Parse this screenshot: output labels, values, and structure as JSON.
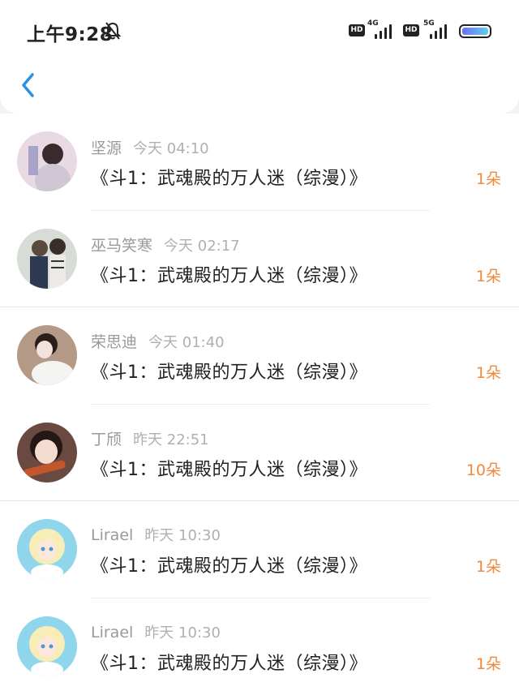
{
  "status_bar": {
    "time": "上午9:28",
    "hd1": "HD",
    "network1": "4G",
    "hd2": "HD",
    "network2": "5G"
  },
  "header": {
    "back_icon": "chevron-left-icon"
  },
  "items": [
    {
      "name": "坚源",
      "time": "今天 04:10",
      "title": "《斗1：武魂殿的万人迷（综漫）》",
      "count": "1朵"
    },
    {
      "name": "巫马笑寒",
      "time": "今天 02:17",
      "title": "《斗1：武魂殿的万人迷（综漫）》",
      "count": "1朵"
    },
    {
      "name": "荣思迪",
      "time": "今天 01:40",
      "title": "《斗1：武魂殿的万人迷（综漫）》",
      "count": "1朵"
    },
    {
      "name": "丁颀",
      "time": "昨天 22:51",
      "title": "《斗1：武魂殿的万人迷（综漫）》",
      "count": "10朵"
    },
    {
      "name": "Lirael",
      "time": "昨天 10:30",
      "title": "《斗1：武魂殿的万人迷（综漫）》",
      "count": "1朵"
    },
    {
      "name": "Lirael",
      "time": "昨天 10:30",
      "title": "《斗1：武魂殿的万人迷（综漫）》",
      "count": "1朵"
    }
  ],
  "colors": {
    "accent": "#2f8ee6",
    "count": "#f08a3c"
  }
}
